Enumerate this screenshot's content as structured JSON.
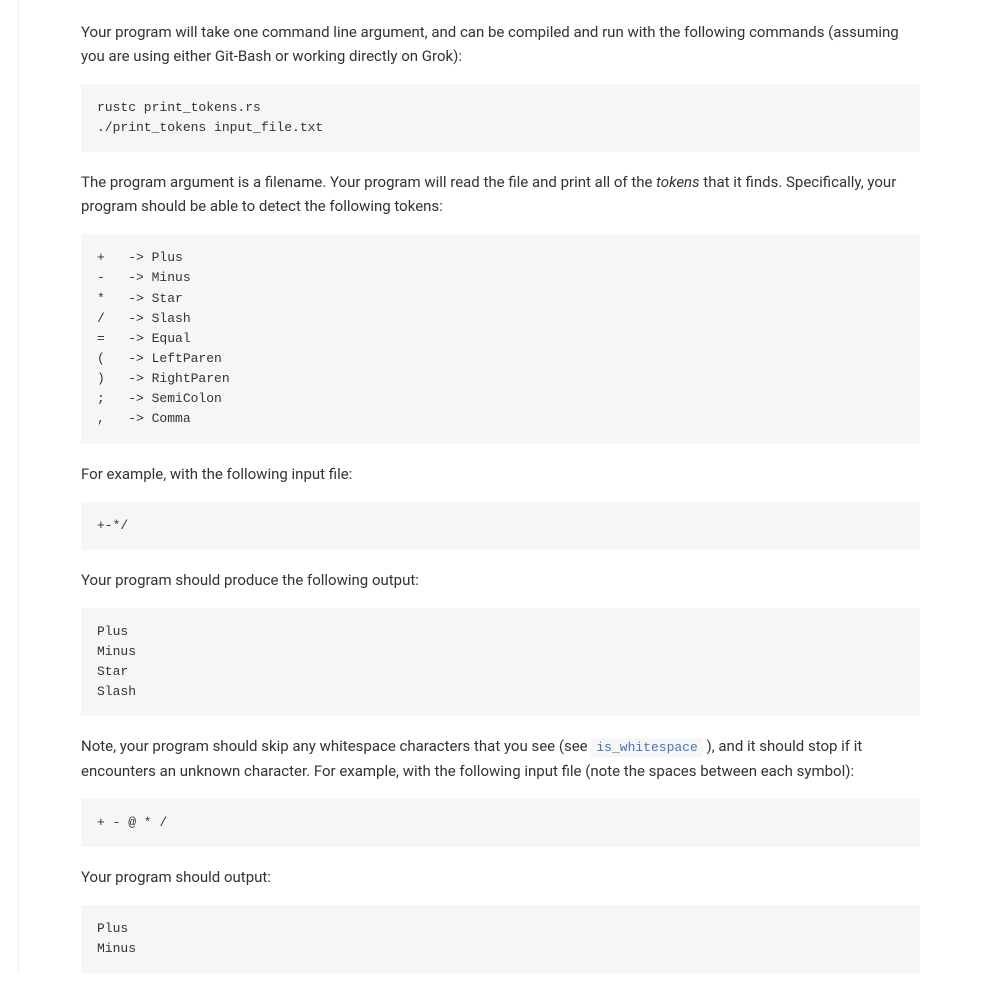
{
  "intro": {
    "para1_pre": "Your program will take one command line argument, and can be compiled and run with the following commands (assuming you are using either Git-Bash or working directly on Grok):"
  },
  "code1": "rustc print_tokens.rs\n./print_tokens input_file.txt",
  "para2": {
    "pre": "The program argument is a filename. Your program will read the file and print all of the ",
    "italic": "tokens",
    "post": " that it finds. Specifically, your program should be able to detect the following tokens:"
  },
  "code2": "+   -> Plus\n-   -> Minus\n*   -> Star\n/   -> Slash\n=   -> Equal\n(   -> LeftParen\n)   -> RightParen\n;   -> SemiColon\n,   -> Comma",
  "para3": "For example, with the following input file:",
  "code3": "+-*/",
  "para4": "Your program should produce the following output:",
  "code4": "Plus\nMinus\nStar\nSlash",
  "para5": {
    "pre": "Note, your program should skip any whitespace characters that you see (see ",
    "code": "is_whitespace",
    "post": " ), and it should stop if it encounters an unknown character. For example, with the following input file (note the spaces between each symbol):"
  },
  "code5": "+ - @ * /",
  "para6": "Your program should output:",
  "code6": "Plus\nMinus"
}
